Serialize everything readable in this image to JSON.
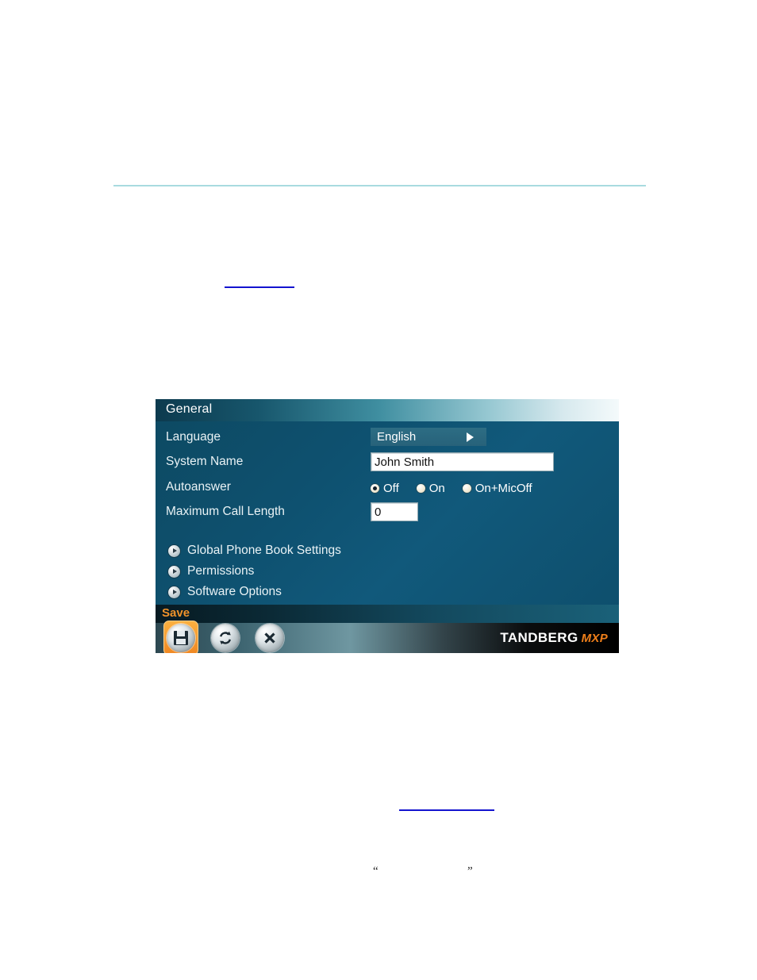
{
  "document": {
    "horizontal_rule": true,
    "link_rules": 2,
    "quote_open": "“",
    "quote_close": "”"
  },
  "panel": {
    "title": "General",
    "rows": [
      {
        "label": "Language",
        "type": "select",
        "value": "English",
        "arrow_icon": "triangle-right-icon"
      },
      {
        "label": "System Name",
        "type": "text",
        "value": "John Smith",
        "placeholder": ""
      },
      {
        "label": "Autoanswer",
        "type": "radio"
      },
      {
        "label": "Maximum Call Length",
        "type": "text",
        "value": "0",
        "placeholder": ""
      }
    ],
    "autoanswer": {
      "options": [
        {
          "label": "Off",
          "selected": true
        },
        {
          "label": "On",
          "selected": false
        },
        {
          "label": "On+MicOff",
          "selected": false
        }
      ]
    },
    "submenu": [
      {
        "label": "Global Phone Book Settings",
        "icon": "arrow-right-circle-icon"
      },
      {
        "label": "Permissions",
        "icon": "arrow-right-circle-icon"
      },
      {
        "label": "Software Options",
        "icon": "arrow-right-circle-icon"
      }
    ],
    "save_bar": {
      "label": "Save"
    },
    "toolbar": {
      "buttons": [
        {
          "name": "save",
          "icon": "floppy-disk-icon",
          "active": true
        },
        {
          "name": "refresh",
          "icon": "refresh-icon",
          "active": false
        },
        {
          "name": "cancel",
          "icon": "close-x-icon",
          "active": false
        }
      ]
    },
    "brand": {
      "main": "TANDBERG",
      "sub": "MXP"
    },
    "colors": {
      "accent_orange": "#ef7f1a",
      "panel_teal": "#0e5170",
      "title_gradient_end": "#f4fafb",
      "rule_blue": "#a8dbdf",
      "link_blue": "#1414cf"
    }
  }
}
